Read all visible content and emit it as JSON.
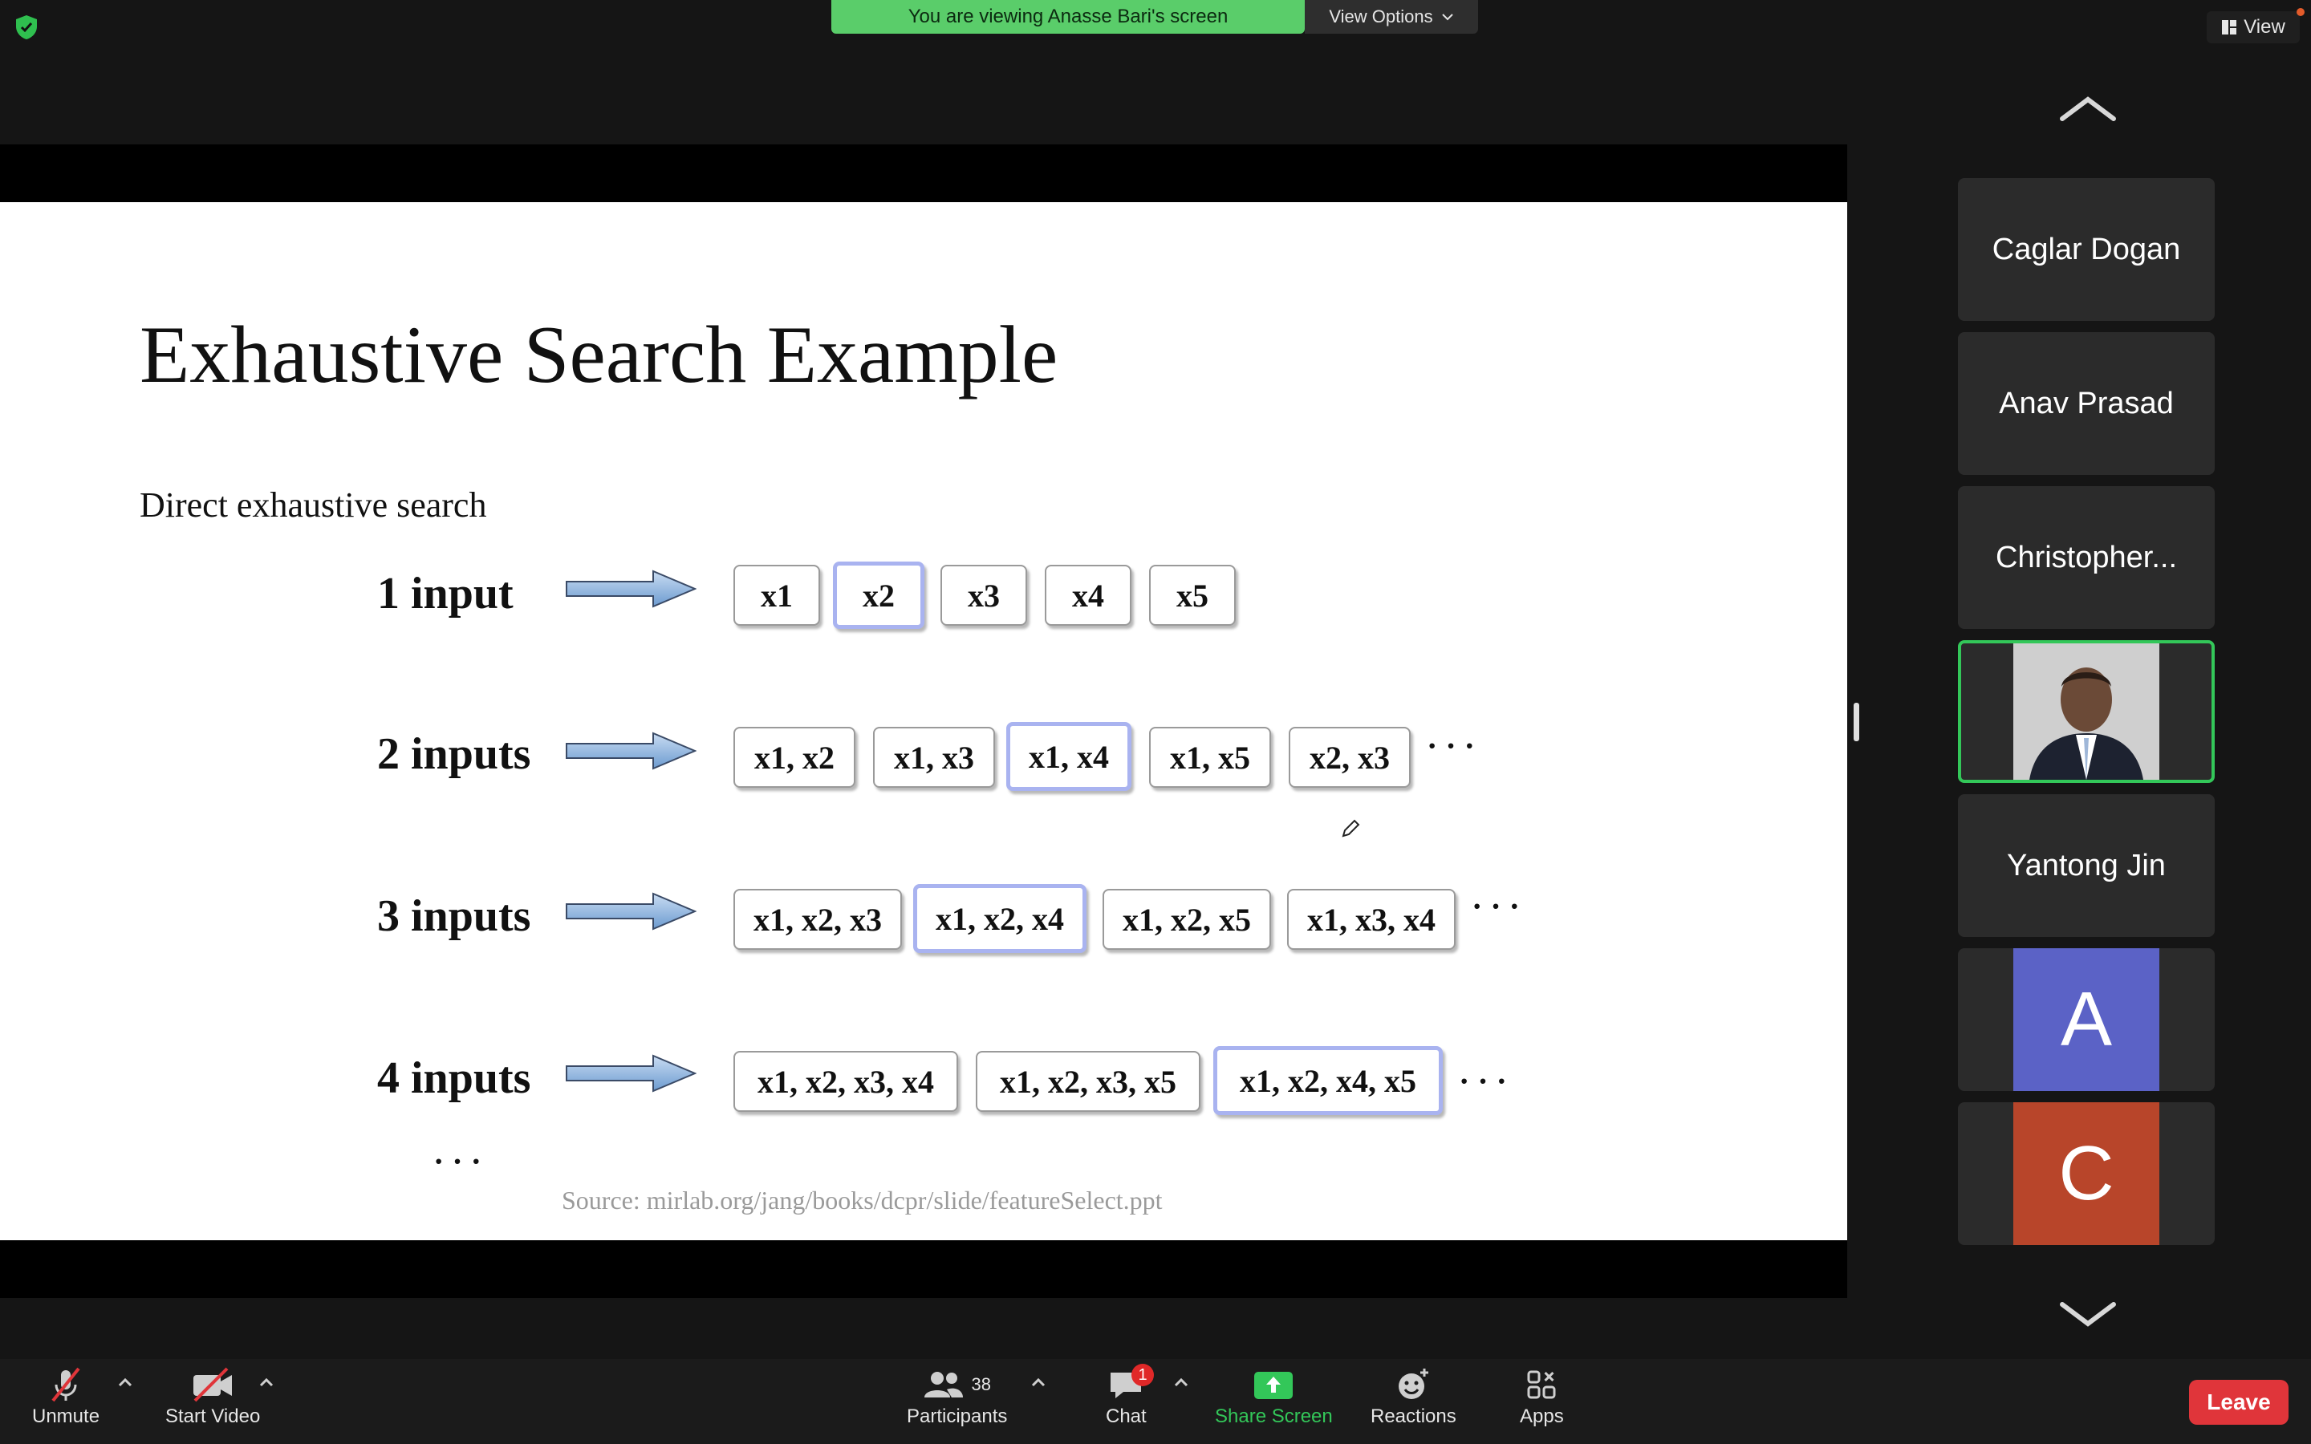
{
  "top": {
    "banner_text": "You are viewing Anasse Bari's screen",
    "view_options_label": "View Options",
    "view_label": "View"
  },
  "slide": {
    "title": "Exhaustive Search Example",
    "subtitle": "Direct exhaustive search",
    "rows": [
      {
        "label": "1 input",
        "items": [
          "x1",
          "x2",
          "x3",
          "x4",
          "x5"
        ],
        "highlight_index": 1,
        "ellipsis": ""
      },
      {
        "label": "2 inputs",
        "items": [
          "x1, x2",
          "x1, x3",
          "x1, x4",
          "x1, x5",
          "x2, x3"
        ],
        "highlight_index": 2,
        "ellipsis": "· · ·"
      },
      {
        "label": "3 inputs",
        "items": [
          "x1, x2, x3",
          "x1, x2, x4",
          "x1, x2, x5",
          "x1, x3, x4"
        ],
        "highlight_index": 1,
        "ellipsis": "· · ·"
      },
      {
        "label": "4 inputs",
        "items": [
          "x1, x2, x3, x4",
          "x1, x2, x3, x5",
          "x1, x2, x4, x5"
        ],
        "highlight_index": 2,
        "ellipsis": "· · ·"
      }
    ],
    "more_rows": "· · ·",
    "source": "Source: mirlab.org/jang/books/dcpr/slide/featureSelect.ppt"
  },
  "participants_panel": {
    "tiles": [
      {
        "kind": "name",
        "name": "Caglar Dogan"
      },
      {
        "kind": "name",
        "name": "Anav Prasad"
      },
      {
        "kind": "name",
        "name": "Christopher..."
      },
      {
        "kind": "photo",
        "active": true
      },
      {
        "kind": "name",
        "name": "Yantong Jin"
      },
      {
        "kind": "avatar",
        "letter": "A",
        "color": "#5b62c6"
      },
      {
        "kind": "avatar",
        "letter": "C",
        "color": "#b8452a"
      }
    ]
  },
  "toolbar": {
    "unmute": "Unmute",
    "start_video": "Start Video",
    "participants": "Participants",
    "participants_count": "38",
    "chat": "Chat",
    "chat_badge": "1",
    "share_screen": "Share Screen",
    "reactions": "Reactions",
    "apps": "Apps",
    "leave": "Leave"
  },
  "colors": {
    "banner_green": "#5acd6a",
    "active_border": "#33c759",
    "share_green": "#33c759",
    "leave_red": "#e0353a",
    "highlight_border": "#a9b3f0"
  }
}
